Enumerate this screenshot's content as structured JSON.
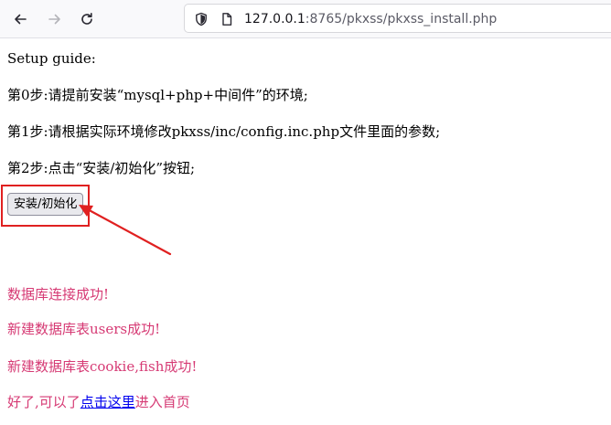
{
  "browser": {
    "url_host": "127.0.0.1",
    "url_rest": ":8765/pkxss/pkxss_install.php"
  },
  "page": {
    "setup_title": "Setup guide:",
    "step0": "第0步:请提前安装“mysql+php+中间件”的环境;",
    "step1": "第1步:请根据实际环境修改pkxss/inc/config.inc.php文件里面的参数;",
    "step2": "第2步:点击“安装/初始化”按钮;",
    "install_button": "安装/初始化",
    "msg_db_connect": "数据库连接成功!",
    "msg_users_table": "新建数据库表users成功!",
    "msg_cookie_fish_table": "新建数据库表cookie,fish成功!",
    "msg_done_prefix": "好了,可以了",
    "msg_done_link": "点击这里",
    "msg_done_suffix": "进入首页"
  },
  "colors": {
    "success_text": "#d63a74",
    "link": "#0000ee",
    "annotation": "#e02020"
  },
  "icons": [
    "back-arrow-icon",
    "forward-arrow-icon",
    "reload-icon",
    "shield-icon",
    "page-icon"
  ]
}
